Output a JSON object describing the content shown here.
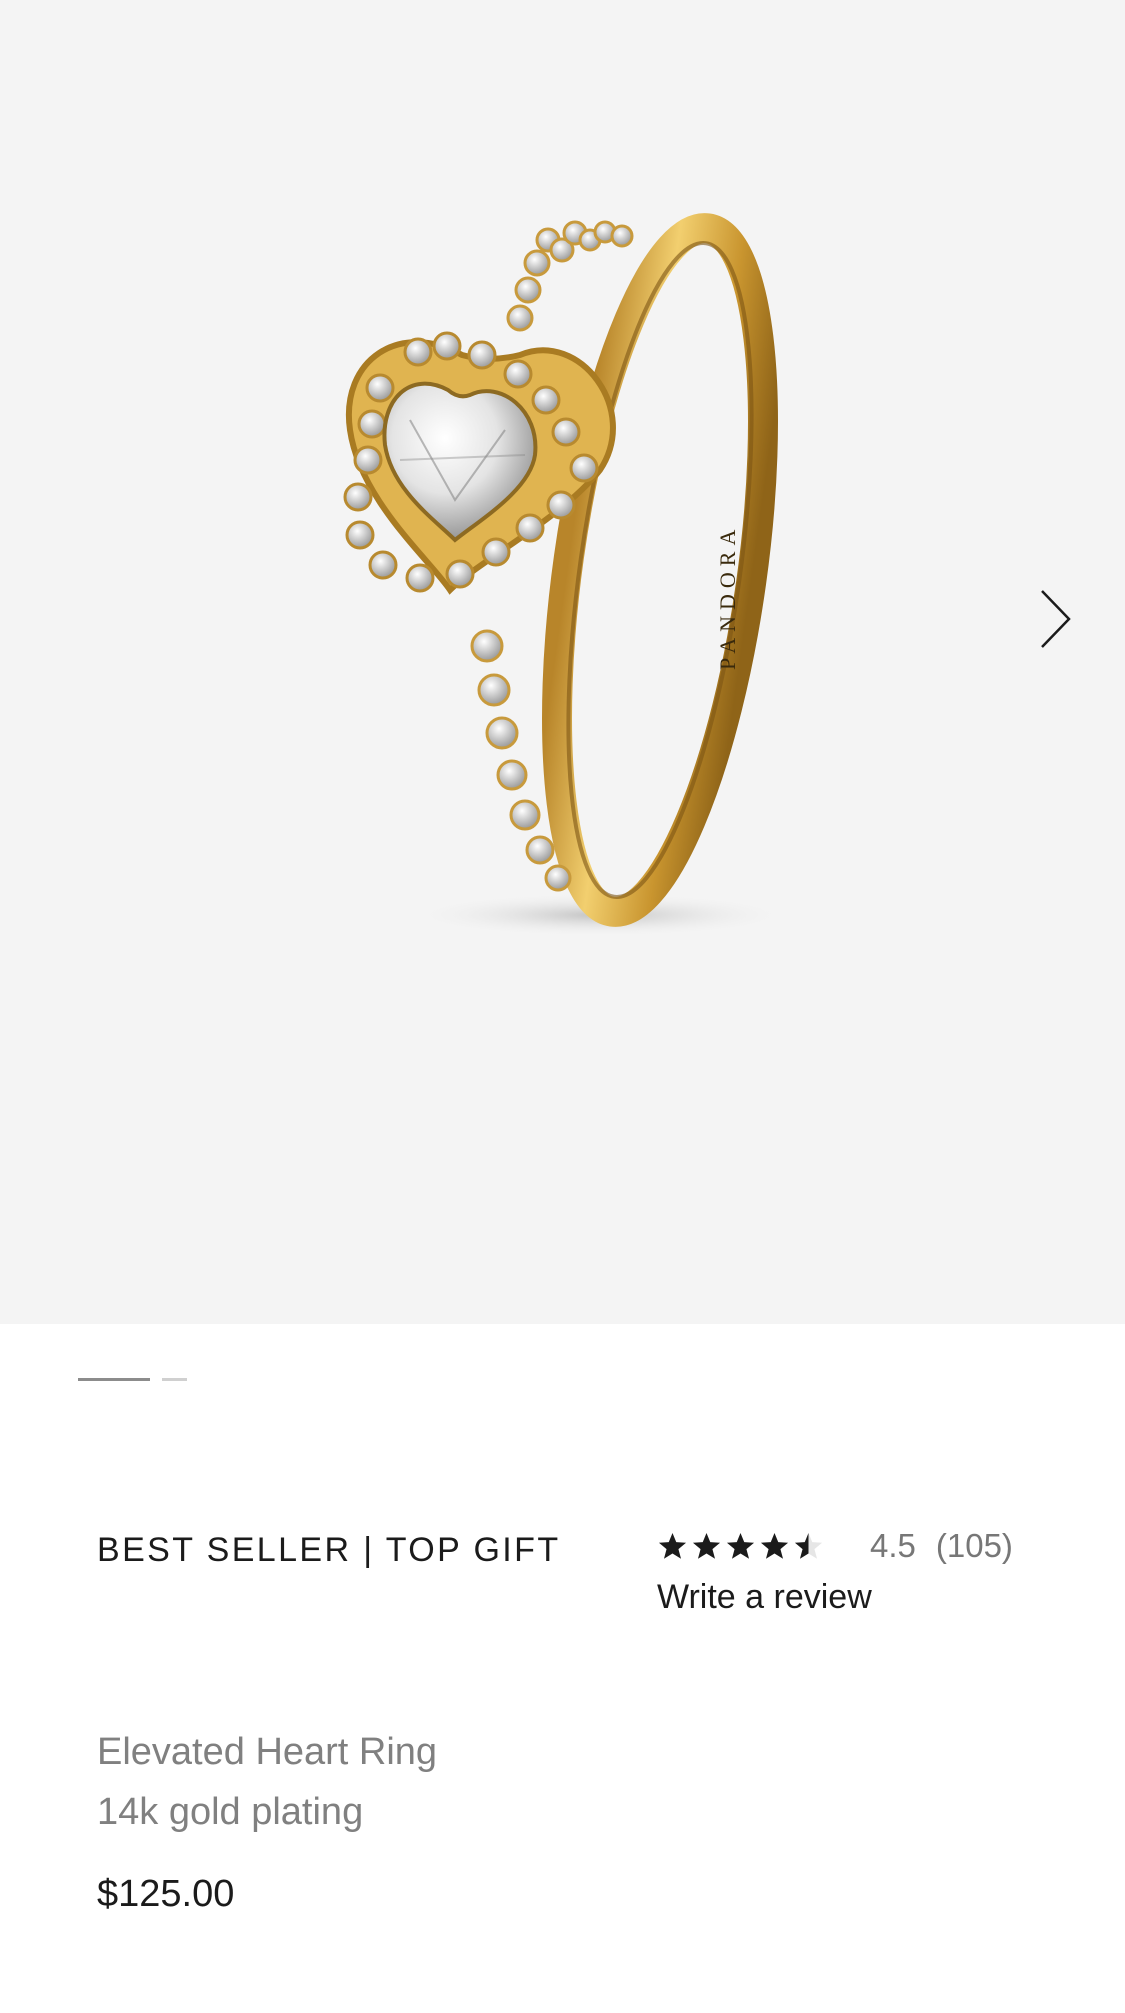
{
  "gallery": {
    "image_alt": "Elevated Heart Ring",
    "engraving": "PANDORA",
    "next_icon": "chevron-right-icon",
    "slide_count": 2,
    "active_slide": 1
  },
  "product": {
    "badge": "BEST SELLER | TOP GIFT",
    "rating": {
      "stars": 4.5,
      "value_text": "4.5",
      "count_text": "(105)",
      "write_review": "Write a review"
    },
    "name": "Elevated Heart Ring",
    "material": "14k gold plating",
    "price": "$125.00"
  },
  "colors": {
    "background": "#ffffff",
    "gallery_background": "#f4f4f4",
    "gold": "#d9a93a",
    "text_primary": "#1b1b1b",
    "text_secondary": "#808080"
  }
}
